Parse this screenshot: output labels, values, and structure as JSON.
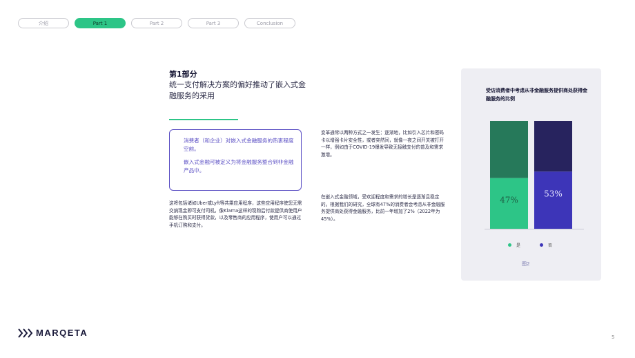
{
  "nav": {
    "tabs": [
      {
        "label": "介绍",
        "active": false
      },
      {
        "label": "Part 1",
        "active": true
      },
      {
        "label": "Part 2",
        "active": false
      },
      {
        "label": "Part 3",
        "active": false
      },
      {
        "label": "Conclusion",
        "active": false
      }
    ]
  },
  "heading": {
    "part": "第1部分",
    "title": "统一支付解决方案的偏好推动了嵌入式金融服务的采用"
  },
  "callout": {
    "line1": "消费者（和企业）对嵌入式金融服务的热衷程度空前。",
    "line2": "嵌入式金融可被定义为将金融服务整合到非金融产品中。"
  },
  "paragraphs": {
    "p1": "这将包括诸如Uber或Lyft等共乘应用程序，这些应用程序使您无需交纳现金即可支付司机，像Klarna这样的现购后付款提供商使用户能够在购买时获得贷款，以及零售商的应用程序，使用户可以通过手机订购和支付。",
    "p2": "变革通常以两种方式之一发生：逐渐地，比如引入芯片和密码卡以增强卡片安全性，或者突然间，就像一夜之间开关被打开一样，例如由于COVID-19爆发导致无接触支付的普及和需求激增。",
    "p3": "在嵌入式金融领域，受欢迎程度和需求的增长是逐渐且稳定的。根据我们的研究，全球有47%的消费者会考虑从非金融服务提供商处获得金融服务，比前一年增加了2%（2022年为45%）。"
  },
  "chart_data": {
    "type": "bar",
    "title": "受访消费者中考虑从非金融服务提供商处获得金融服务的比例",
    "categories": [
      "是",
      "否"
    ],
    "values": [
      47,
      53
    ],
    "value_labels": [
      "47%",
      "53%"
    ],
    "ylim": [
      0,
      100
    ],
    "colors": {
      "fill": [
        "#2dc587",
        "#3d35b8"
      ],
      "rest": [
        "#26795a",
        "#27235e"
      ]
    },
    "legend": [
      {
        "label": "是",
        "color": "#2dc587"
      },
      {
        "label": "否",
        "color": "#3d35b8"
      }
    ],
    "figure_label": "图2"
  },
  "footer": {
    "brand": "MARQETA",
    "page_number": "5"
  }
}
